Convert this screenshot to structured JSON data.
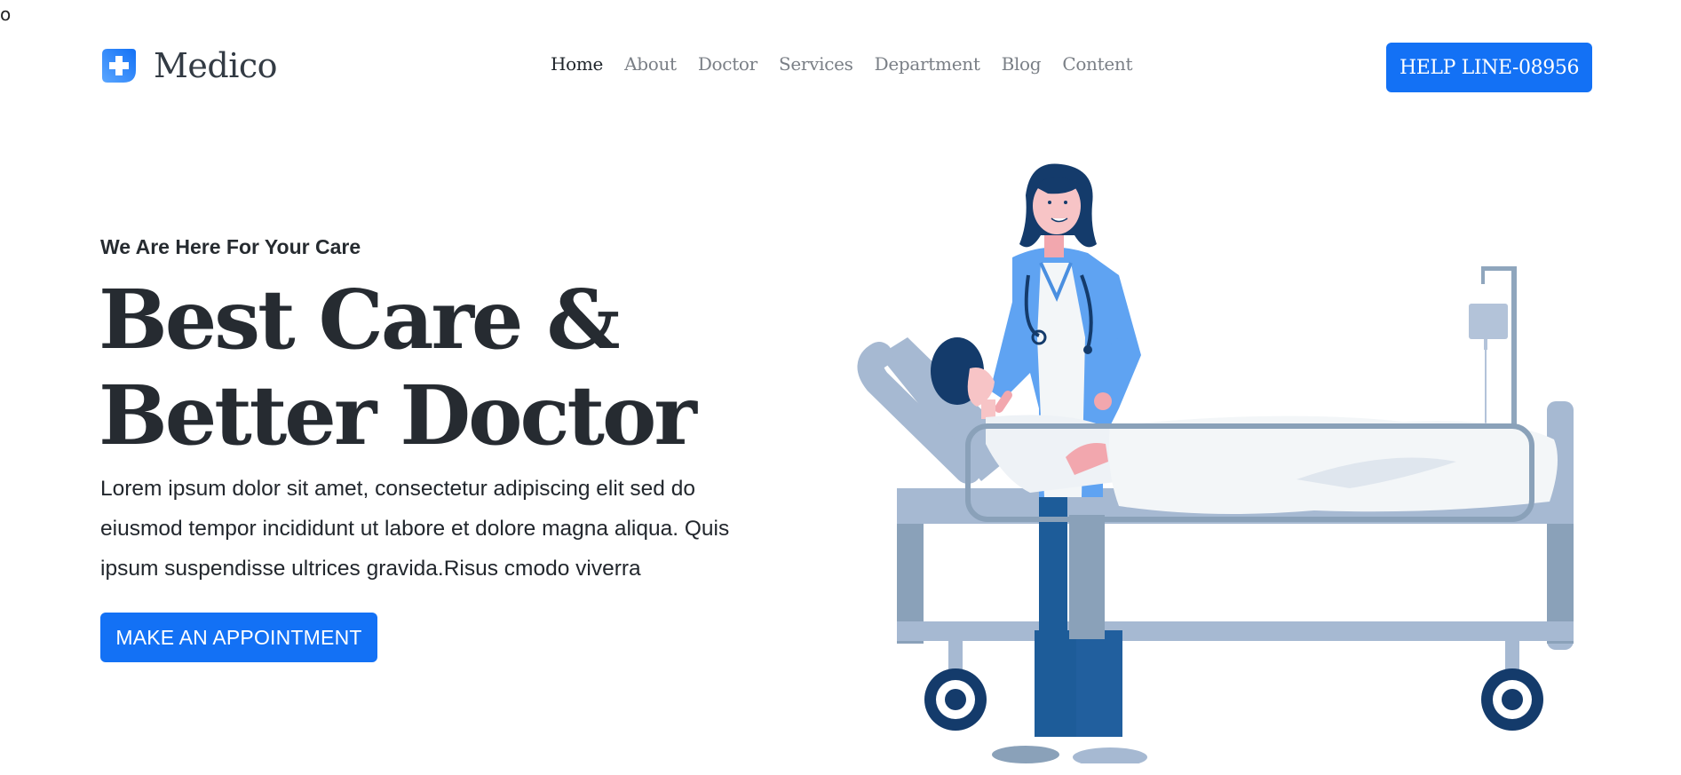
{
  "stray_mark": "o",
  "brand": {
    "name": "Medico",
    "icon": "medical-cross-icon"
  },
  "nav": {
    "items": [
      {
        "label": "Home",
        "active": true
      },
      {
        "label": "About",
        "active": false
      },
      {
        "label": "Doctor",
        "active": false
      },
      {
        "label": "Services",
        "active": false
      },
      {
        "label": "Department",
        "active": false
      },
      {
        "label": "Blog",
        "active": false
      },
      {
        "label": "Content",
        "active": false
      }
    ]
  },
  "header": {
    "helpline_label": "HELP LINE-08956"
  },
  "hero": {
    "eyebrow": "We Are Here For Your Care",
    "title_line_1": "Best Care &",
    "title_line_2": "Better Doctor",
    "description": "Lorem ipsum dolor sit amet, consectetur adipiscing elit sed do eiusmod tempor incididunt ut labore et dolore magna aliqua. Quis ipsum suspendisse ultrices gravida.Risus cmodo viverra",
    "cta_label": "MAKE AN APPOINTMENT"
  },
  "colors": {
    "primary": "#1371f5",
    "heading": "#262b31",
    "nav_muted": "#7a7f86"
  }
}
